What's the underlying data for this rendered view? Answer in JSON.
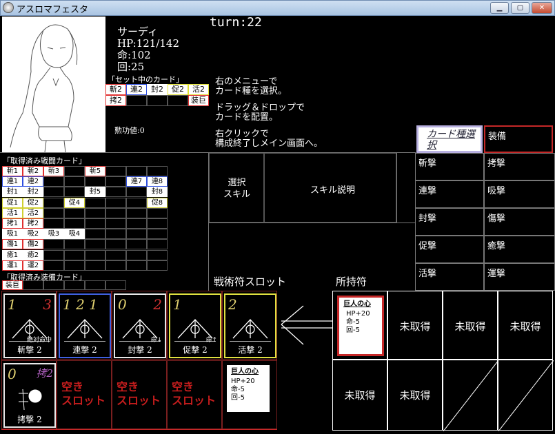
{
  "window": {
    "title": "アスロマフェスタ",
    "btn_minimize": "▁",
    "btn_maximize": "▢",
    "btn_close": "✕"
  },
  "character": {
    "name": "サーディ",
    "hp": "HP:121/142",
    "hit": "命:102",
    "evade": "回:25",
    "merit": "勲功値:0"
  },
  "set_cards": {
    "title": "「セット中のカード」",
    "row1": [
      {
        "t": "斬2",
        "c": "#e03030"
      },
      {
        "t": "連2",
        "c": "#3050e0"
      },
      {
        "t": "封2",
        "c": "#ffffff"
      },
      {
        "t": "促2",
        "c": "#e0e030"
      },
      {
        "t": "活2",
        "c": "#e0e030"
      }
    ],
    "row2": [
      {
        "t": "拷2",
        "c": "#e03030"
      },
      {
        "t": "",
        "c": ""
      },
      {
        "t": "",
        "c": ""
      },
      {
        "t": "",
        "c": ""
      },
      {
        "t": "装巨",
        "c": "#e03030"
      }
    ]
  },
  "turn": "turn:22",
  "instructions": [
    "右のメニューで",
    "カード種を選択。",
    "ドラッグ＆ドロップで",
    "カードを配置。",
    "右クリックで",
    "構成終了しメイン画面へ。"
  ],
  "skill": {
    "select_label_1": "選択",
    "select_label_2": "スキル",
    "desc_label": "スキル説明"
  },
  "acquired_battle": {
    "title": "「取得済み戦闘カード」",
    "rows": [
      [
        "斬1",
        "斬2",
        "斬3",
        "",
        "斬5",
        "",
        "",
        ""
      ],
      [
        "連1",
        "連2",
        "",
        "",
        "",
        "",
        "連7",
        "連8"
      ],
      [
        "封1",
        "封2",
        "",
        "",
        "封5",
        "",
        "",
        "封8"
      ],
      [
        "促1",
        "促2",
        "",
        "促4",
        "",
        "",
        "",
        "促8"
      ],
      [
        "活1",
        "活2",
        "",
        "",
        "",
        "",
        "",
        ""
      ],
      [
        "拷1",
        "拷2",
        "",
        "",
        "",
        "",
        "",
        ""
      ],
      [
        "吸1",
        "吸2",
        "吸3",
        "吸4",
        "",
        "",
        "",
        ""
      ],
      [
        "傷1",
        "傷2",
        "",
        "",
        "",
        "",
        "",
        ""
      ],
      [
        "癒1",
        "癒2",
        "",
        "",
        "",
        "",
        "",
        ""
      ],
      [
        "運1",
        "運2",
        "",
        "",
        "",
        "",
        "",
        ""
      ]
    ]
  },
  "acquired_equip": {
    "title": "「取得済み装備カード」",
    "first": "装巨"
  },
  "card_types": {
    "header": "カード種選択",
    "equip": "装備",
    "left": [
      "斬撃",
      "連撃",
      "封撃",
      "促撃",
      "活撃"
    ],
    "right": [
      "拷撃",
      "吸撃",
      "傷撃",
      "癒撃",
      "運撃"
    ]
  },
  "tactics_slot_label": "戦術符スロット",
  "owned_label": "所持符",
  "slots": [
    {
      "a": "1",
      "b": "3",
      "name": "斬撃 2",
      "border": "#e8e8e8",
      "extra": "絶対命中"
    },
    {
      "a": "1 2 1",
      "b": "",
      "name": "連撃 2",
      "border": "#4060e0",
      "extra": ""
    },
    {
      "a": "0",
      "b": "2",
      "name": "封撃 2",
      "border": "#e8e8e8",
      "extra": "命↓"
    },
    {
      "a": "1",
      "b": "",
      "name": "促撃 2",
      "border": "#e0e040",
      "extra": "命↑"
    },
    {
      "a": "2",
      "b": "",
      "name": "活撃 2",
      "border": "#e0e040",
      "extra": ""
    }
  ],
  "slot_row2": {
    "card": {
      "a": "0",
      "b": "拷2",
      "name": "拷撃 2"
    },
    "empty": "空き\nスロット",
    "empty_lines": [
      "空き",
      "スロット"
    ]
  },
  "equip_card": {
    "title": "巨人の心",
    "lines": [
      "HP+20",
      "命-5",
      "回-5"
    ]
  },
  "owned": {
    "unacquired": "未取得"
  },
  "colors": {
    "red": "#c61d1d",
    "border_red": "#c62828",
    "lav": "#b8b0e0"
  }
}
